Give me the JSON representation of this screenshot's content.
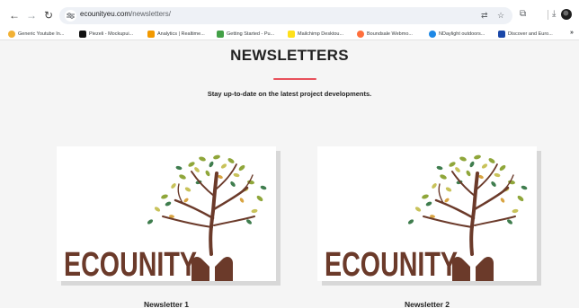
{
  "browser": {
    "url_host": "ecounityeu.com",
    "url_path": "/newsletters/",
    "bookmarks": [
      {
        "label": "Generic Youtube In...",
        "color": "#f2b134"
      },
      {
        "label": "Piezeli - Mockupui...",
        "color": "#111111"
      },
      {
        "label": "Analytics | Realtime...",
        "color": "#f29900"
      },
      {
        "label": "Getting Started - Pu...",
        "color": "#43a047"
      },
      {
        "label": "Mailchimp Desktou...",
        "color": "#ffe01b"
      },
      {
        "label": "Boundsale Webmo...",
        "color": "#ff6f3c"
      },
      {
        "label": "NDaylight outdoors...",
        "color": "#1e88e5"
      },
      {
        "label": "Discover and Euro...",
        "color": "#1a47a8"
      }
    ],
    "bookmarks_more": "»"
  },
  "page": {
    "title": "NEWSLETTERS",
    "subtitle": "Stay up-to-date on the latest project developments.",
    "accent_color": "#e8505b"
  },
  "newsletters": [
    {
      "title": "Newsletter 1",
      "logo_text": "ECOUNITY"
    },
    {
      "title": "Newsletter 2",
      "logo_text": "ECOUNITY"
    }
  ]
}
